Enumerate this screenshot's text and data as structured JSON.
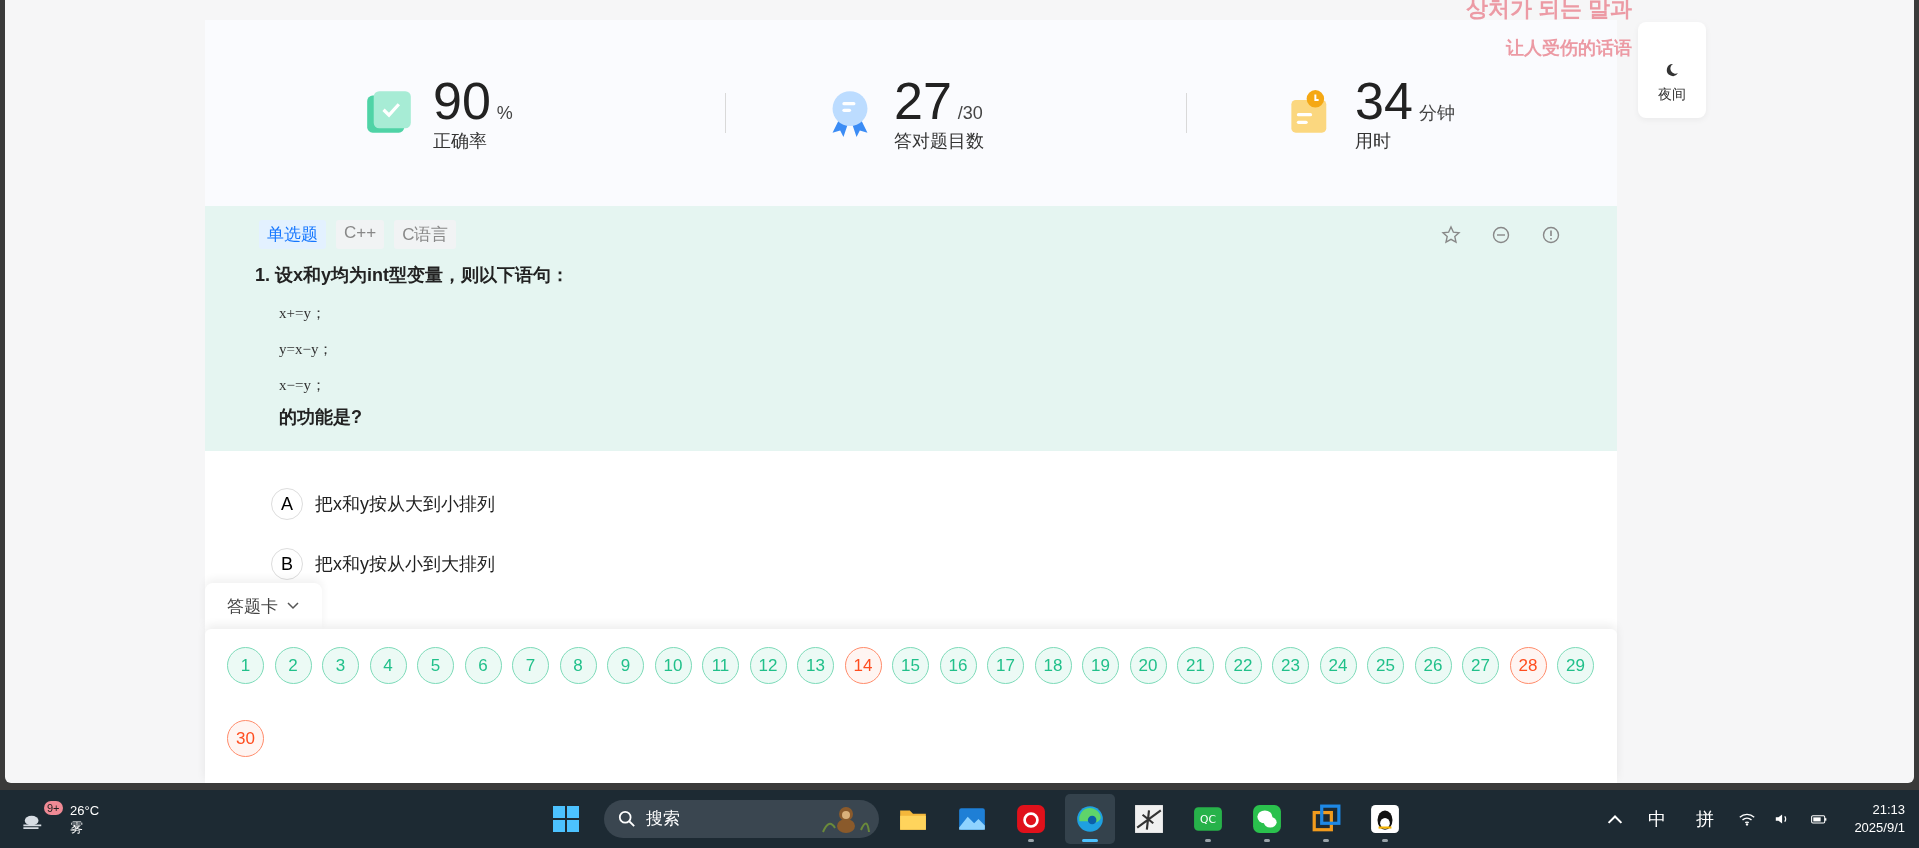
{
  "overlay_lyrics": [
    "상처가 되는 말과",
    "让人受伤的话语"
  ],
  "night_mode": {
    "label": "夜间"
  },
  "stats": [
    {
      "kind": "accuracy",
      "value": "90",
      "unit": "%",
      "label": "正确率"
    },
    {
      "kind": "count",
      "value": "27",
      "unit": "/30",
      "label": "答对题目数"
    },
    {
      "kind": "time",
      "value": "34",
      "unit": "分钟",
      "label": "用时"
    }
  ],
  "question": {
    "tags": [
      {
        "label": "单选题",
        "selected": true
      },
      {
        "label": "C++",
        "selected": false
      },
      {
        "label": "C语言",
        "selected": false
      }
    ],
    "title": "1. 设x和y均为int型变量，则以下语句：",
    "code_lines": [
      "x+=y；",
      "y=x−y；",
      "x−=y；"
    ],
    "ending": "的功能是?"
  },
  "options": [
    {
      "letter": "A",
      "text": "把x和y按从大到小排列"
    },
    {
      "letter": "B",
      "text": "把x和y按从小到大排列"
    }
  ],
  "answer_card": {
    "title": "答题卡",
    "expanded": true,
    "items": [
      {
        "label": "1",
        "wrong": false
      },
      {
        "label": "2",
        "wrong": false
      },
      {
        "label": "3",
        "wrong": false
      },
      {
        "label": "4",
        "wrong": false
      },
      {
        "label": "5",
        "wrong": false
      },
      {
        "label": "6",
        "wrong": false
      },
      {
        "label": "7",
        "wrong": false
      },
      {
        "label": "8",
        "wrong": false
      },
      {
        "label": "9",
        "wrong": false
      },
      {
        "label": "10",
        "wrong": false
      },
      {
        "label": "11",
        "wrong": false
      },
      {
        "label": "12",
        "wrong": false
      },
      {
        "label": "13",
        "wrong": false
      },
      {
        "label": "14",
        "wrong": true
      },
      {
        "label": "15",
        "wrong": false
      },
      {
        "label": "16",
        "wrong": false
      },
      {
        "label": "17",
        "wrong": false
      },
      {
        "label": "18",
        "wrong": false
      },
      {
        "label": "19",
        "wrong": false
      },
      {
        "label": "20",
        "wrong": false
      },
      {
        "label": "21",
        "wrong": false
      },
      {
        "label": "22",
        "wrong": false
      },
      {
        "label": "23",
        "wrong": false
      },
      {
        "label": "24",
        "wrong": false
      },
      {
        "label": "25",
        "wrong": false
      },
      {
        "label": "26",
        "wrong": false
      },
      {
        "label": "27",
        "wrong": false
      },
      {
        "label": "28",
        "wrong": true
      },
      {
        "label": "29",
        "wrong": false
      },
      {
        "label": "30",
        "wrong": true
      }
    ]
  },
  "taskbar": {
    "weather": {
      "badge": "9+",
      "temp": "26°C",
      "condition": "雾"
    },
    "search_placeholder": "搜索",
    "apps": [
      {
        "kind": "folder",
        "running": false,
        "active": false
      },
      {
        "kind": "photos",
        "running": false,
        "active": false
      },
      {
        "kind": "music",
        "running": true,
        "active": false
      },
      {
        "kind": "browser",
        "running": true,
        "active": true
      },
      {
        "kind": "plane",
        "running": false,
        "active": false
      },
      {
        "kind": "qc",
        "running": true,
        "active": false
      },
      {
        "kind": "chat",
        "running": true,
        "active": false
      },
      {
        "kind": "boxes",
        "running": true,
        "active": false
      },
      {
        "kind": "penguin",
        "running": true,
        "active": false
      }
    ],
    "qc_label": "QC",
    "ime": [
      "中",
      "拼"
    ],
    "time": "21:13",
    "date": "2025/9/1"
  }
}
